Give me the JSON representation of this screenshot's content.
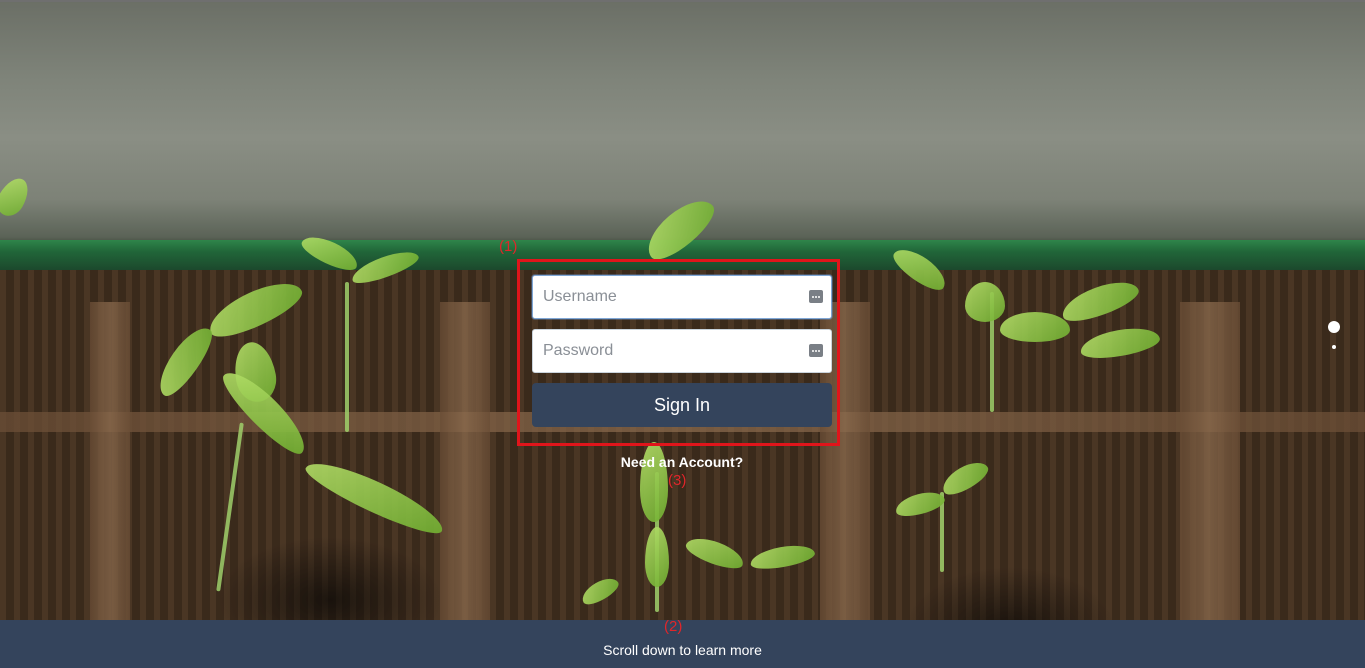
{
  "login_form": {
    "username_placeholder": "Username",
    "password_placeholder": "Password",
    "sign_in_label": "Sign In",
    "need_account_label": "Need an Account?"
  },
  "footer": {
    "scroll_hint": "Scroll down to learn more"
  },
  "annotations": {
    "form_marker": "(1)",
    "footer_marker": "(2)",
    "account_marker": "(3)"
  },
  "icons": {
    "field_icon": "password-manager-key-icon",
    "carousel_dots": "carousel-indicator-dots"
  },
  "colors": {
    "primary": "#34445c",
    "annotation": "#e0151b",
    "text_light": "#ffffff"
  }
}
